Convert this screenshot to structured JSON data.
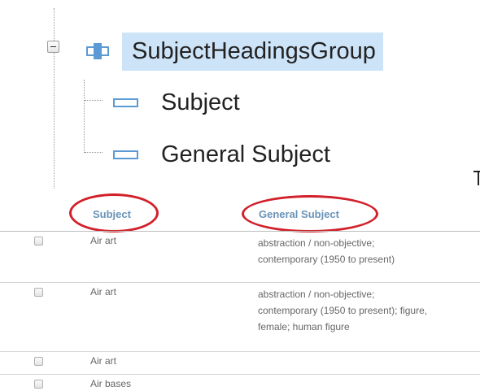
{
  "tree": {
    "group": {
      "label": "SubjectHeadingsGroup",
      "expanded": true,
      "expander_icon": "minus-expander-icon",
      "icon": "group-node-icon"
    },
    "children": [
      {
        "label": "Subject",
        "icon": "field-node-icon"
      },
      {
        "label": "General Subject",
        "icon": "field-node-icon"
      }
    ]
  },
  "grid": {
    "columns": [
      {
        "label": "Subject",
        "highlighted": true
      },
      {
        "label": "General Subject",
        "highlighted": true
      }
    ],
    "rows": [
      {
        "checked": false,
        "subject": "Air art",
        "general_subject": "abstraction / non-objective; contemporary (1950 to present)"
      },
      {
        "checked": false,
        "subject": "Air art",
        "general_subject": "abstraction / non-objective; contemporary (1950 to present); figure, female; human figure"
      },
      {
        "checked": false,
        "subject": "Air art",
        "general_subject": ""
      },
      {
        "checked": false,
        "subject": "Air bases",
        "general_subject": ""
      }
    ]
  },
  "colors": {
    "selection_bg": "#cde3f7",
    "node_icon": "#5b9ad4",
    "column_header": "#6a93b8",
    "annotation_circle": "#d2202a"
  }
}
